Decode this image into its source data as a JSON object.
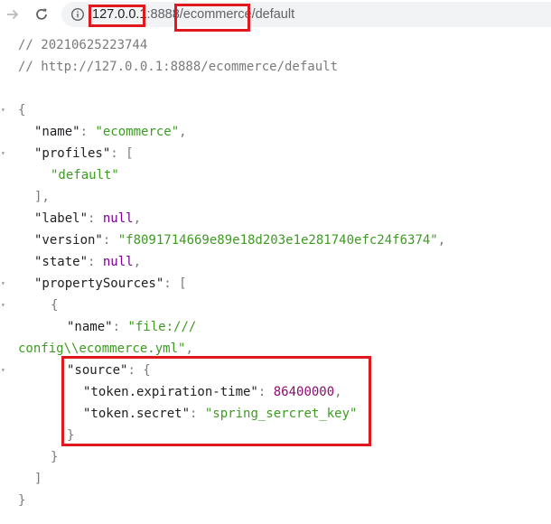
{
  "browser": {
    "url_host": "127.0.0.1",
    "url_port": ":8888",
    "url_path_1": "/ecommerce",
    "url_path_2": "/default"
  },
  "viewer": {
    "comment_timestamp": "// 20210625223744",
    "comment_url": "// http://127.0.0.1:8888/ecommerce/default",
    "keys": {
      "name": "\"name\"",
      "profiles": "\"profiles\"",
      "label": "\"label\"",
      "version": "\"version\"",
      "state": "\"state\"",
      "propertySources": "\"propertySources\"",
      "ps_name": "\"name\"",
      "source": "\"source\"",
      "token_expiration": "\"token.expiration-time\"",
      "token_secret": "\"token.secret\""
    },
    "values": {
      "name": "\"ecommerce\"",
      "profile_0": "\"default\"",
      "label": "null",
      "version": "\"f8091714669e89e18d203e1e281740efc24f6374\"",
      "state": "null",
      "ps_name_part1": "\"file:///",
      "ps_name_part2": "config\\\\ecommerce.yml\"",
      "token_expiration": "86400000",
      "token_secret": "\"spring_sercret_key\""
    }
  },
  "colors": {
    "highlight": "#e0191f",
    "string": "#3d9b22",
    "keyword": "#7a0090"
  }
}
